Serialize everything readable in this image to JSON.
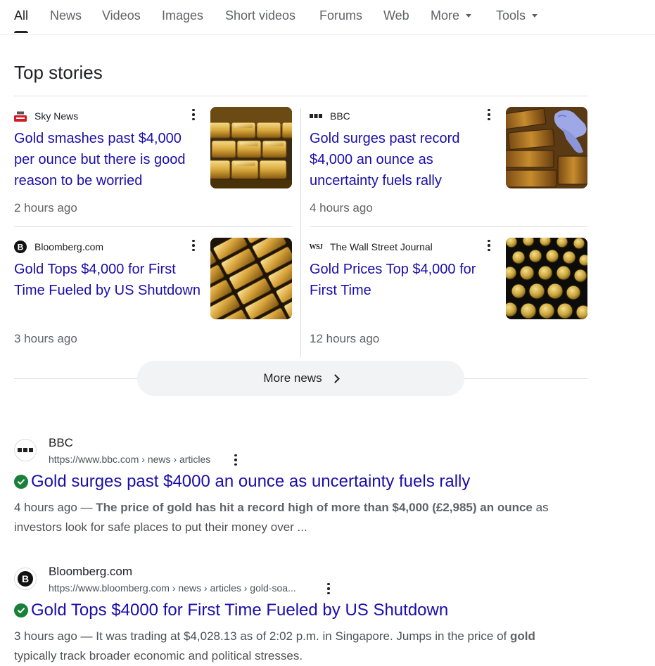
{
  "tabs": [
    {
      "label": "All",
      "active": true
    },
    {
      "label": "News"
    },
    {
      "label": "Videos"
    },
    {
      "label": "Images"
    },
    {
      "label": "Short videos"
    },
    {
      "label": "Forums"
    },
    {
      "label": "Web"
    },
    {
      "label": "More",
      "dropdown": true
    },
    {
      "label": "Tools",
      "dropdown": true
    }
  ],
  "top_stories": {
    "title": "Top stories",
    "cards": [
      {
        "source": "Sky News",
        "logo": "sky-news-logo",
        "headline": "Gold smashes past $4,000 per ounce but there is good reason to be worried",
        "time": "2 hours ago",
        "thumb": "gold-bars-stack"
      },
      {
        "source": "BBC",
        "logo": "bbc-logo",
        "headline": "Gold surges past record $4,000 an ounce as uncertainty fuels rally",
        "time": "4 hours ago",
        "thumb": "gold-bars-glove"
      },
      {
        "source": "Bloomberg.com",
        "logo": "bloomberg-logo",
        "headline": "Gold Tops $4,000 for First Time Fueled by US Shutdown",
        "time": "3 hours ago",
        "thumb": "gold-bars-rows"
      },
      {
        "source": "The Wall Street Journal",
        "logo": "wsj-logo",
        "logo_text": "WSJ",
        "headline": "Gold Prices Top $4,000 for First Time",
        "time": "12 hours ago",
        "thumb": "gold-coins-tray"
      }
    ],
    "more_news_label": "More news"
  },
  "results": [
    {
      "site": "BBC",
      "url": "https://www.bbc.com › news › articles",
      "title": "Gold surges past $4000 an ounce as uncertainty fuels rally",
      "date": "4 hours ago",
      "dash": " — ",
      "snippet_bold": "The price of gold has hit a record high of more than $4,000 (£2,985) an ounce",
      "snippet_rest": " as investors look for safe places to put their money over ..."
    },
    {
      "site": "Bloomberg.com",
      "url": "https://www.bloomberg.com › news › articles › gold-soa...",
      "title": "Gold Tops $4000 for First Time Fueled by US Shutdown",
      "date": "3 hours ago",
      "dash": " — ",
      "snippet_a": "It was trading at $4,028.13 as of 2:02 p.m. in Singapore. Jumps in the price of ",
      "snippet_bold": "gold",
      "snippet_rest": " typically track broader economic and political stresses."
    }
  ],
  "colors": {
    "link": "#1a0dab",
    "verified": "#188038",
    "muted": "#5f6368"
  }
}
